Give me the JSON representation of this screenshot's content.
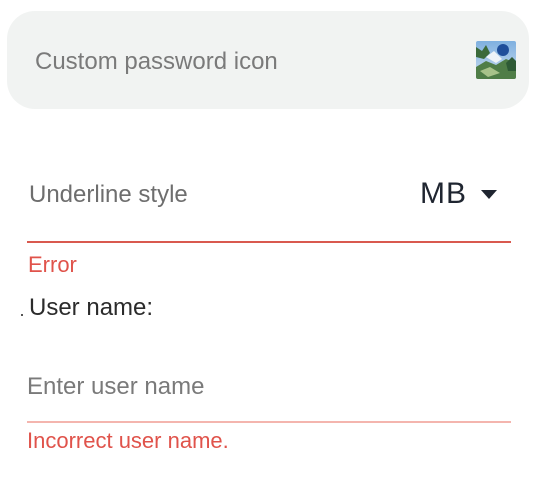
{
  "password_field": {
    "placeholder": "Custom password icon",
    "icon": "landscape-image-icon"
  },
  "underline_field": {
    "label": "Underline style",
    "unit_value": "MB",
    "dropdown_icon": "caret-down-icon",
    "error": "Error",
    "colors": {
      "underline": "#d9594f",
      "error_text": "#e0534b"
    }
  },
  "username_field": {
    "label": "User name:",
    "placeholder": "Enter user name",
    "error": "Incorrect user name.",
    "colors": {
      "underline": "#f4b5ae"
    }
  }
}
